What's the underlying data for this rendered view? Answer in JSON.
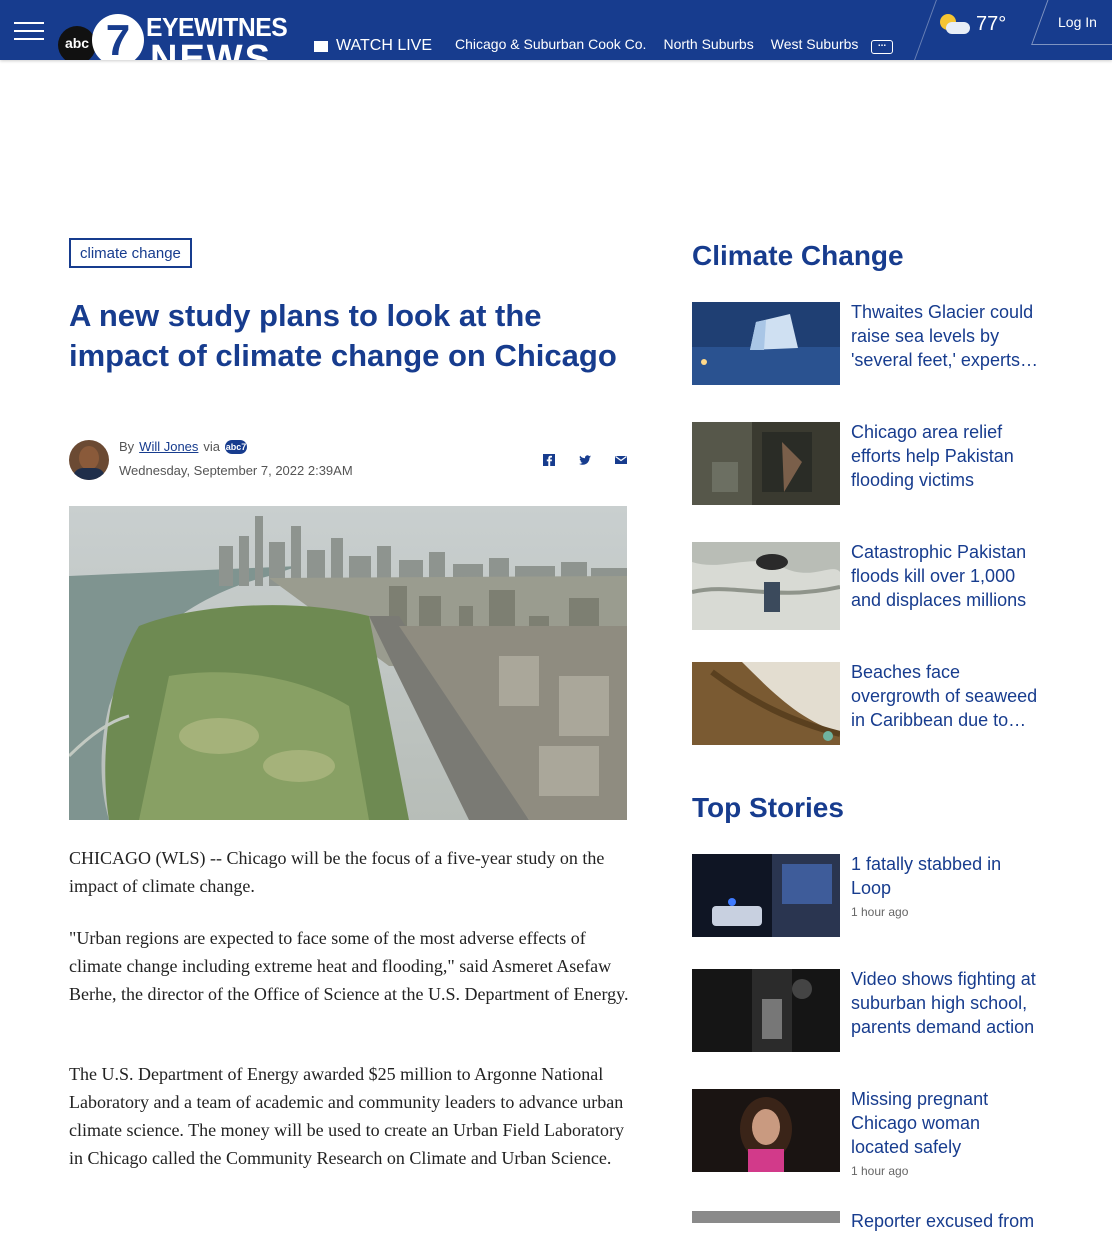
{
  "nav": {
    "brand_abc": "abc",
    "brand_seven": "7",
    "brand_line1": "EYEWITNESS",
    "brand_line2": "NEWS",
    "watch_live": "WATCH LIVE",
    "links": [
      "Chicago & Suburban Cook Co.",
      "North Suburbs",
      "West Suburbs"
    ],
    "more": "...",
    "temperature": "77°",
    "login": "Log In"
  },
  "article": {
    "tag": "climate change",
    "headline": "A new study plans to look at the impact of climate change on Chicago",
    "by": "By",
    "author": "Will Jones",
    "via": "via",
    "station": "abc7",
    "date": "Wednesday, September 7, 2022 2:39AM",
    "paragraphs": [
      "CHICAGO (WLS) -- Chicago will be the focus of a five-year study on the impact of climate change.",
      "\"Urban regions are expected to face some of the most adverse effects of climate change including extreme heat and flooding,\" said Asmeret Asefaw Berhe, the director of the Office of Science at the U.S. Department of Energy.",
      "The U.S. Department of Energy awarded $25 million to Argonne National Laboratory and a team of academic and community leaders to advance urban climate science. The money will be used to create an Urban Field Laboratory in Chicago called the Community Research on Climate and Urban Science."
    ]
  },
  "sidebar": {
    "climate_title": "Climate Change",
    "climate_items": [
      {
        "title": "Thwaites Glacier could raise sea levels by 'several feet,' experts say"
      },
      {
        "title": "Chicago area relief efforts help Pakistan flooding victims"
      },
      {
        "title": "Catastrophic Pakistan floods kill over 1,000 and displaces millions"
      },
      {
        "title": "Beaches face overgrowth of seaweed in Caribbean due to climate change"
      }
    ],
    "top_title": "Top Stories",
    "top_items": [
      {
        "title": "1 fatally stabbed in Loop",
        "time": "1 hour ago"
      },
      {
        "title": "Video shows fighting at suburban high school, parents demand action",
        "time": ""
      },
      {
        "title": "Missing pregnant Chicago woman located safely",
        "time": "1 hour ago"
      },
      {
        "title": "Reporter excused from",
        "time": ""
      }
    ]
  }
}
